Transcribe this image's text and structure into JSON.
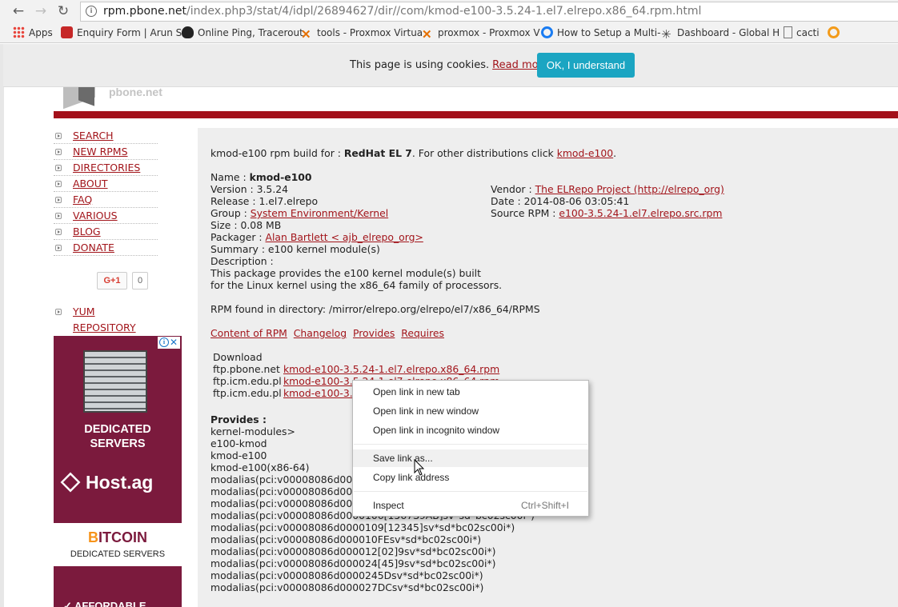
{
  "browser": {
    "url_host": "rpm.pbone.net",
    "url_path": "/index.php3/stat/4/idpl/26894627/dir//com/kmod-e100-3.5.24-1.el7.elrepo.x86_64.rpm.html",
    "bookmarks": [
      {
        "label": "Apps",
        "icon": "apps-grid-icon"
      },
      {
        "label": "Enquiry Form | Arun S",
        "icon": "favicon-icon"
      },
      {
        "label": "Online Ping, Tracerout",
        "icon": "penguin-icon"
      },
      {
        "label": "tools - Proxmox Virtua",
        "icon": "proxmox-icon"
      },
      {
        "label": "proxmox - Proxmox V",
        "icon": "proxmox-icon"
      },
      {
        "label": "How to Setup a Multi-",
        "icon": "digitalocean-icon"
      },
      {
        "label": "Dashboard - Global H",
        "icon": "gear-icon"
      },
      {
        "label": "cacti",
        "icon": "page-icon"
      }
    ]
  },
  "cookie": {
    "message": "This page is using cookies.",
    "read_more": "Read more",
    "button": "OK, I understand"
  },
  "logo": {
    "text": "pbone.net"
  },
  "menu": [
    "SEARCH",
    "NEW RPMS",
    "DIRECTORIES",
    "ABOUT",
    "FAQ",
    "VARIOUS",
    "BLOG",
    "DONATE"
  ],
  "gplus": {
    "label": "G+1",
    "count": "0"
  },
  "yum": "YUM REPOSITORY",
  "ad": {
    "dedicated": "DEDICATED",
    "servers": "SERVERS",
    "host": "Host.ag",
    "bitcoin": "ITCOIN",
    "bitcoin_b": "B",
    "bitcoin_sub": "DEDICATED SERVERS",
    "affordable": "✓ AFFORDABLE"
  },
  "pkg": {
    "intro_pre": "kmod-e100 rpm build for : ",
    "intro_os": "RedHat EL 7",
    "intro_mid": ". For other distributions click ",
    "intro_link": "kmod-e100",
    "intro_end": ".",
    "name_label": "Name : ",
    "name": "kmod-e100",
    "version": "Version : 3.5.24",
    "release": "Release : 1.el7.elrepo",
    "group_label": "Group : ",
    "group": "System Environment/Kernel",
    "size": "Size : 0.08 MB",
    "packager_label": "Packager : ",
    "packager": "Alan Bartlett < ajb_elrepo_org>",
    "summary": "Summary : e100 kernel module(s)",
    "description": "Description :",
    "desc1": "This package provides the e100 kernel module(s) built",
    "desc2": "for the Linux kernel using the x86_64 family of processors.",
    "vendor_label": "Vendor : ",
    "vendor": "The ELRepo Project (http://elrepo_org)",
    "date": "Date : 2014-08-06 03:05:41",
    "srpm_label": "Source RPM : ",
    "srpm": "e100-3.5.24-1.el7.elrepo.src.rpm",
    "found": "RPM found in directory: /mirror/elrepo.org/elrepo/el7/x86_64/RPMS",
    "tabs": [
      "Content of RPM",
      "Changelog",
      "Provides",
      "Requires"
    ],
    "download": "Download",
    "mirrors": [
      {
        "host": "ftp.pbone.net",
        "file": "kmod-e100-3.5.24-1.el7.elrepo.x86_64.rpm"
      },
      {
        "host": "ftp.icm.edu.pl",
        "file": "kmod-e100-3.5.24-1.el7.elrepo.x86_64.rpm"
      },
      {
        "host": "ftp.icm.edu.pl",
        "file": "kmod-e100-3.5.24-1.el7.elrepo.x86_64.rpm"
      }
    ],
    "provides_title": "Provides :",
    "provides": [
      "kernel-modules>",
      "e100-kmod",
      "kmod-e100",
      "kmod-e100(x86-64)",
      "modalias(pci:v00008086d0000",
      "modalias(pci:v00008086d0000",
      "modalias(pci:v00008086d0000",
      "modalias(pci:v00008086d0000106[1567S9AB]sv*sd*bc02sc00i*)",
      "modalias(pci:v00008086d0000109[12345]sv*sd*bc02sc00i*)",
      "modalias(pci:v00008086d000010FEsv*sd*bc02sc00i*)",
      "modalias(pci:v00008086d000012[02]9sv*sd*bc02sc00i*)",
      "modalias(pci:v00008086d000024[45]9sv*sd*bc02sc00i*)",
      "modalias(pci:v00008086d0000245Dsv*sd*bc02sc00i*)",
      "modalias(pci:v00008086d000027DCsv*sd*bc02sc00i*)"
    ]
  },
  "context_menu": {
    "items": [
      {
        "label": "Open link in new tab",
        "shortcut": ""
      },
      {
        "label": "Open link in new window",
        "shortcut": ""
      },
      {
        "label": "Open link in incognito window",
        "shortcut": ""
      },
      {
        "label": "Save link as...",
        "shortcut": ""
      },
      {
        "label": "Copy link address",
        "shortcut": ""
      },
      {
        "label": "Inspect",
        "shortcut": "Ctrl+Shift+I"
      }
    ],
    "highlighted": 3
  }
}
